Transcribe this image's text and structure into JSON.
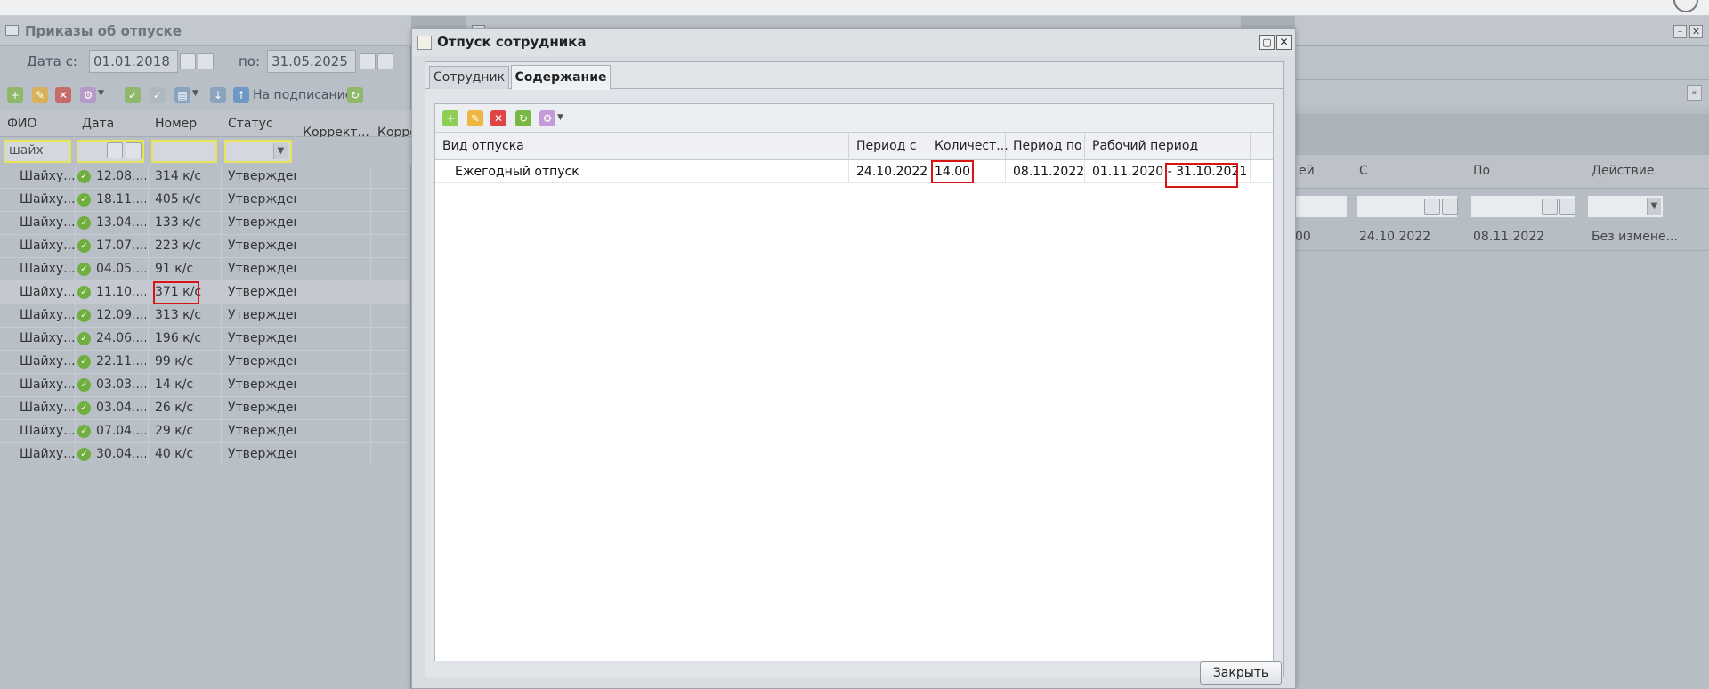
{
  "top_strip": {},
  "left_panel": {
    "title": "Приказы об отпуске",
    "date_from_label": "Дата с:",
    "date_from_value": "01.01.2018",
    "date_to_label": "по:",
    "date_to_value": "31.05.2025",
    "toolbar_sign_label": "На подписание",
    "columns": [
      "ФИО",
      "Дата",
      "Номер",
      "Статус",
      "Коррект...",
      "Корре"
    ],
    "filter_fio_value": "шайх",
    "rows": [
      {
        "fio": "Шайху...",
        "date": "12.08....",
        "num": "314 к/с",
        "status": "Утвержден"
      },
      {
        "fio": "Шайху...",
        "date": "18.11....",
        "num": "405 к/с",
        "status": "Утвержден"
      },
      {
        "fio": "Шайху...",
        "date": "13.04....",
        "num": "133 к/с",
        "status": "Утвержден"
      },
      {
        "fio": "Шайху...",
        "date": "17.07....",
        "num": "223 к/с",
        "status": "Утвержден"
      },
      {
        "fio": "Шайху...",
        "date": "04.05....",
        "num": "91 к/с",
        "status": "Утвержден"
      },
      {
        "fio": "Шайху...",
        "date": "11.10....",
        "num": "371 к/с",
        "status": "Утвержден"
      },
      {
        "fio": "Шайху...",
        "date": "12.09....",
        "num": "313 к/с",
        "status": "Утвержден"
      },
      {
        "fio": "Шайху...",
        "date": "24.06....",
        "num": "196 к/с",
        "status": "Утвержден"
      },
      {
        "fio": "Шайху...",
        "date": "22.11....",
        "num": "99 к/с",
        "status": "Утвержден"
      },
      {
        "fio": "Шайху...",
        "date": "03.03....",
        "num": "14 к/с",
        "status": "Утвержден"
      },
      {
        "fio": "Шайху...",
        "date": "03.04....",
        "num": "26 к/с",
        "status": "Утвержден"
      },
      {
        "fio": "Шайху...",
        "date": "07.04....",
        "num": "29 к/с",
        "status": "Утвержден"
      },
      {
        "fio": "Шайху...",
        "date": "30.04....",
        "num": "40 к/с",
        "status": "Утвержден"
      }
    ]
  },
  "right_panel": {
    "col_partial": "ей",
    "col_s": "С",
    "col_po": "По",
    "col_action": "Действие",
    "row_partial": "00",
    "row_s": "24.10.2022",
    "row_po": "08.11.2022",
    "row_action": "Без измене..."
  },
  "dialog": {
    "title": "Отпуск сотрудника",
    "tab_employee": "Сотрудник",
    "tab_content": "Содержание",
    "columns": [
      "Вид отпуска",
      "Период с",
      "Количест...",
      "Период по",
      "Рабочий период"
    ],
    "row": {
      "type": "Ежегодный отпуск",
      "period_from": "24.10.2022",
      "quantity": "14.00",
      "period_to": "08.11.2022",
      "work_period_start": "01.11.2020 -",
      "work_period_end": "31.10.2021"
    },
    "close_button": "Закрыть"
  },
  "colors": {
    "highlight_red": "#d81515",
    "filter_yellow": "#e8e45a",
    "selected_row": "#c4c9d1"
  }
}
